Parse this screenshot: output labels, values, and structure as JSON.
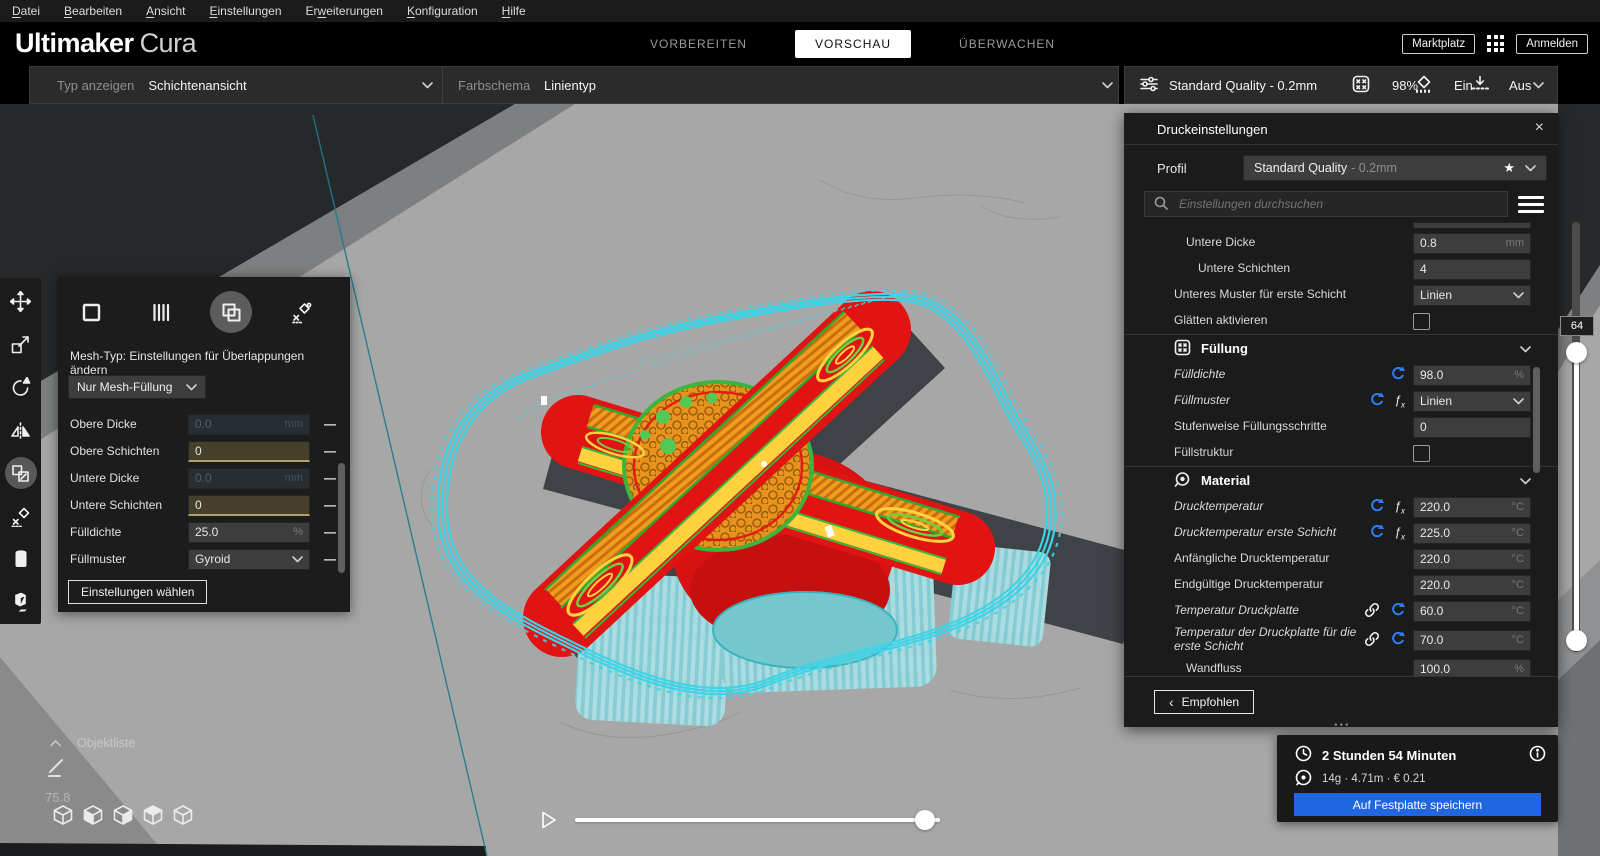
{
  "menu": {
    "items": [
      {
        "label": "Datei",
        "u": 0
      },
      {
        "label": "Bearbeiten",
        "u": 0
      },
      {
        "label": "Ansicht",
        "u": 0
      },
      {
        "label": "Einstellungen",
        "u": 0
      },
      {
        "label": "Erweiterungen",
        "u": 2
      },
      {
        "label": "Konfiguration",
        "u": 0
      },
      {
        "label": "Hilfe",
        "u": 0
      }
    ]
  },
  "header": {
    "logo_bold": "Ultimaker",
    "logo_light": "Cura",
    "tabs": [
      {
        "label": "VORBEREITEN",
        "active": false
      },
      {
        "label": "VORSCHAU",
        "active": true
      },
      {
        "label": "ÜBERWACHEN",
        "active": false
      }
    ],
    "marketplace": "Marktplatz",
    "signin": "Anmelden"
  },
  "view_toolbar": {
    "type_label": "Typ anzeigen",
    "type_value": "Schichtenansicht",
    "scheme_label": "Farbschema",
    "scheme_value": "Linientyp"
  },
  "printer_toolbar": {
    "profile": "Standard Quality - 0.2mm",
    "infill": "98%",
    "support": "Ein",
    "adhesion": "Aus"
  },
  "left_toolbar": {
    "tools": [
      "move",
      "scale",
      "rotate",
      "mirror",
      "per-model-settings",
      "support-blocker",
      "support-eraser",
      "model-drop"
    ],
    "selected": 4
  },
  "mesh_panel": {
    "modes": [
      "normal-mesh",
      "print-as-support",
      "modify-overlaps",
      "dont-support-overlaps"
    ],
    "selected_mode": 2,
    "description": "Mesh-Typ: Einstellungen für Überlappungen ändern",
    "mesh_type_value": "Nur Mesh-Füllung",
    "rows": [
      {
        "label": "Obere Dicke",
        "value": "0.0",
        "unit": "mm",
        "state": "disabled"
      },
      {
        "label": "Obere Schichten",
        "value": "0",
        "unit": "",
        "state": "highlight"
      },
      {
        "label": "Untere Dicke",
        "value": "0.0",
        "unit": "mm",
        "state": "disabled"
      },
      {
        "label": "Untere Schichten",
        "value": "0",
        "unit": "",
        "state": "highlight"
      },
      {
        "label": "Fülldichte",
        "value": "25.0",
        "unit": "%",
        "state": "normal"
      },
      {
        "label": "Füllmuster",
        "value": "Gyroid",
        "state": "select"
      }
    ],
    "button": "Einstellungen wählen"
  },
  "right_panel": {
    "title": "Druckeinstellungen",
    "profile_label": "Profil",
    "profile_value": "Standard Quality",
    "profile_suffix": "- 0.2mm",
    "search_placeholder": "Einstellungen durchsuchen",
    "rows": [
      {
        "type": "input",
        "label": "Untere Dicke",
        "value": "0.8",
        "unit": "mm",
        "indent": 1
      },
      {
        "type": "input",
        "label": "Untere Schichten",
        "value": "4",
        "unit": "",
        "indent": 2
      },
      {
        "type": "select",
        "label": "Unteres Muster für erste Schicht",
        "value": "Linien",
        "indent": 0
      },
      {
        "type": "checkbox",
        "label": "Glätten aktivieren",
        "checked": false,
        "indent": 0
      },
      {
        "type": "section",
        "label": "Füllung",
        "icon": "infill"
      },
      {
        "type": "input",
        "label": "Fülldichte",
        "value": "98.0",
        "unit": "%",
        "modified": true,
        "icons": [
          "revert"
        ]
      },
      {
        "type": "select",
        "label": "Füllmuster",
        "value": "Linien",
        "modified": true,
        "icons": [
          "revert",
          "fx"
        ]
      },
      {
        "type": "input",
        "label": "Stufenweise Füllungsschritte",
        "value": "0",
        "unit": ""
      },
      {
        "type": "checkbox",
        "label": "Füllstruktur",
        "checked": false
      },
      {
        "type": "section",
        "label": "Material",
        "icon": "material"
      },
      {
        "type": "input",
        "label": "Drucktemperatur",
        "value": "220.0",
        "unit": "°C",
        "modified": true,
        "icons": [
          "revert",
          "fx"
        ]
      },
      {
        "type": "input",
        "label": "Drucktemperatur erste Schicht",
        "value": "225.0",
        "unit": "°C",
        "modified": true,
        "icons": [
          "revert",
          "fx"
        ]
      },
      {
        "type": "input",
        "label": "Anfängliche Drucktemperatur",
        "value": "220.0",
        "unit": "°C"
      },
      {
        "type": "input",
        "label": "Endgültige Drucktemperatur",
        "value": "220.0",
        "unit": "°C"
      },
      {
        "type": "input",
        "label": "Temperatur Druckplatte",
        "value": "60.0",
        "unit": "°C",
        "modified": true,
        "icons": [
          "link",
          "revert"
        ]
      },
      {
        "type": "input",
        "label": "Temperatur der Druckplatte für die erste Schicht",
        "value": "70.0",
        "unit": "°C",
        "modified": true,
        "icons": [
          "link",
          "revert"
        ],
        "twoline": true
      },
      {
        "type": "input",
        "label": "Wandfluss",
        "value": "100.0",
        "unit": "%",
        "indent": 1
      }
    ],
    "recommended_button": "Empfohlen"
  },
  "layer_slider": {
    "value": "64"
  },
  "object_list": {
    "label": "Objektliste",
    "measure": "75.8"
  },
  "job_panel": {
    "time": "2 Stunden 54 Minuten",
    "material": "14g · 4.71m · € 0.21",
    "save_button": "Auf Festplatte speichern"
  },
  "colors": {
    "accent_blue": "#2066e0",
    "modified_blue": "#2d7ef7",
    "skirt_cyan": "#3fd3e6",
    "wall_red": "#e21313",
    "infill_orange": "#e8941c",
    "skin_yellow": "#ffd23e",
    "skin_green": "#3cb53c",
    "highlight_olive": "#46402a",
    "plate_gray": "#a7a7a7",
    "panel_dark": "#1b1b1b"
  }
}
